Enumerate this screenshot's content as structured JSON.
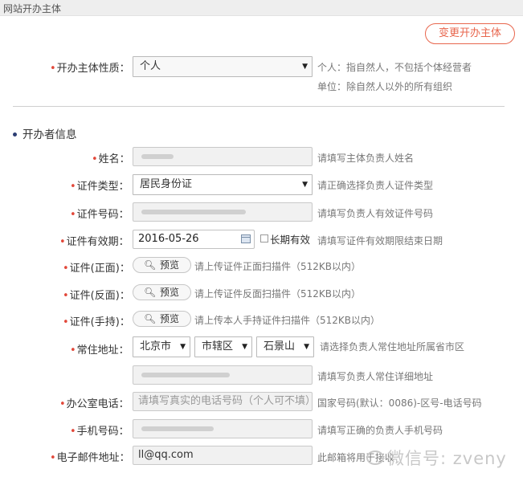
{
  "header": {
    "title": "网站开办主体"
  },
  "change_button": "变更开办主体",
  "nature": {
    "label": "开办主体性质：",
    "value": "个人",
    "hint_line1": "个人：指自然人，不包括个体经营者",
    "hint_line2": "单位：除自然人以外的所有组织"
  },
  "section_title": "开办者信息",
  "fields": {
    "name": {
      "label": "姓名：",
      "hint": "请填写主体负责人姓名"
    },
    "id_type": {
      "label": "证件类型：",
      "value": "居民身份证",
      "hint": "请正确选择负责人证件类型"
    },
    "id_number": {
      "label": "证件号码：",
      "hint": "请填写负责人有效证件号码"
    },
    "id_validity": {
      "label": "证件有效期：",
      "value": "2016-05-26",
      "long_term_label": "长期有效",
      "hint": "请填写证件有效期限结束日期"
    },
    "id_front": {
      "label": "证件(正面)：",
      "button": "预览",
      "hint": "请上传证件正面扫描件（512KB以内）"
    },
    "id_back": {
      "label": "证件(反面)：",
      "button": "预览",
      "hint": "请上传证件反面扫描件（512KB以内）"
    },
    "id_handheld": {
      "label": "证件(手持)：",
      "button": "预览",
      "hint": "请上传本人手持证件扫描件（512KB以内）"
    },
    "address": {
      "label": "常住地址：",
      "province": "北京市",
      "district": "市辖区",
      "county": "石景山",
      "region_hint": "请选择负责人常住地址所属省市区",
      "detail_hint": "请填写负责人常住详细地址"
    },
    "office_phone": {
      "label": "办公室电话：",
      "placeholder": "请填写真实的电话号码（个人可不填）",
      "hint": "国家号码(默认：0086)-区号-电话号码"
    },
    "mobile": {
      "label": "手机号码：",
      "hint": "请填写正确的负责人手机号码"
    },
    "email": {
      "label": "电子邮件地址：",
      "value": "ll@qq.com",
      "hint": "此邮箱将用于接收"
    }
  },
  "watermark": "微信号: zveny",
  "icons": {
    "dropdown": "chevron-down-icon",
    "preview": "magnifier-icon",
    "calendar": "calendar-icon",
    "bullet": "bullet-dot-icon"
  },
  "colors": {
    "accent": "#e8664d",
    "required_star": "#e2483a",
    "bullet": "#2c3e73"
  }
}
